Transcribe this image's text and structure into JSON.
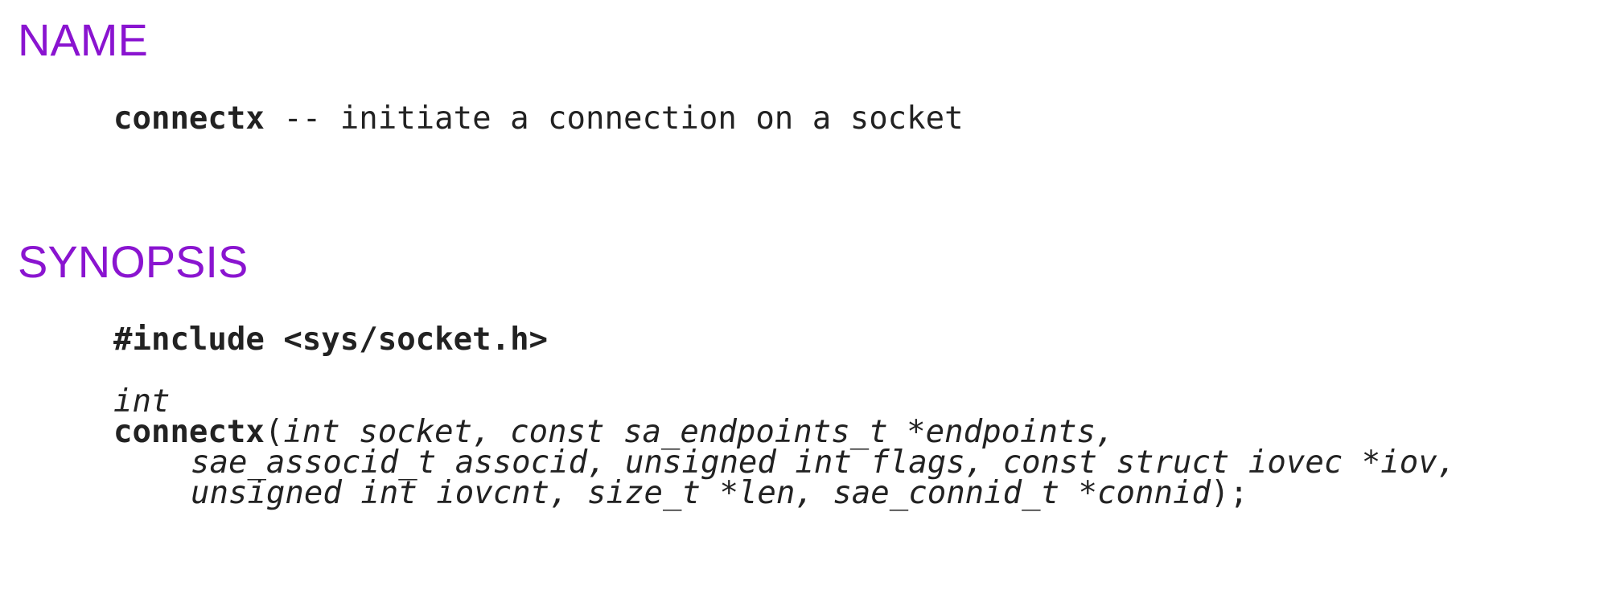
{
  "name_section": {
    "heading": "NAME",
    "command": "connectx",
    "description": " -- initiate a connection on a socket"
  },
  "synopsis_section": {
    "heading": "SYNOPSIS",
    "include": "#include <sys/socket.h>",
    "return_type": "int",
    "function_name": "connectx",
    "prototype": {
      "open_paren": "(",
      "close_paren": ");",
      "line1_params": "int socket, const sa_endpoints_t *endpoints,",
      "line2_params": "sae_associd_t associd, unsigned int flags, const struct iovec *iov,",
      "line3_params": "unsigned int iovcnt, size_t *len, sae_connid_t *connid"
    }
  }
}
